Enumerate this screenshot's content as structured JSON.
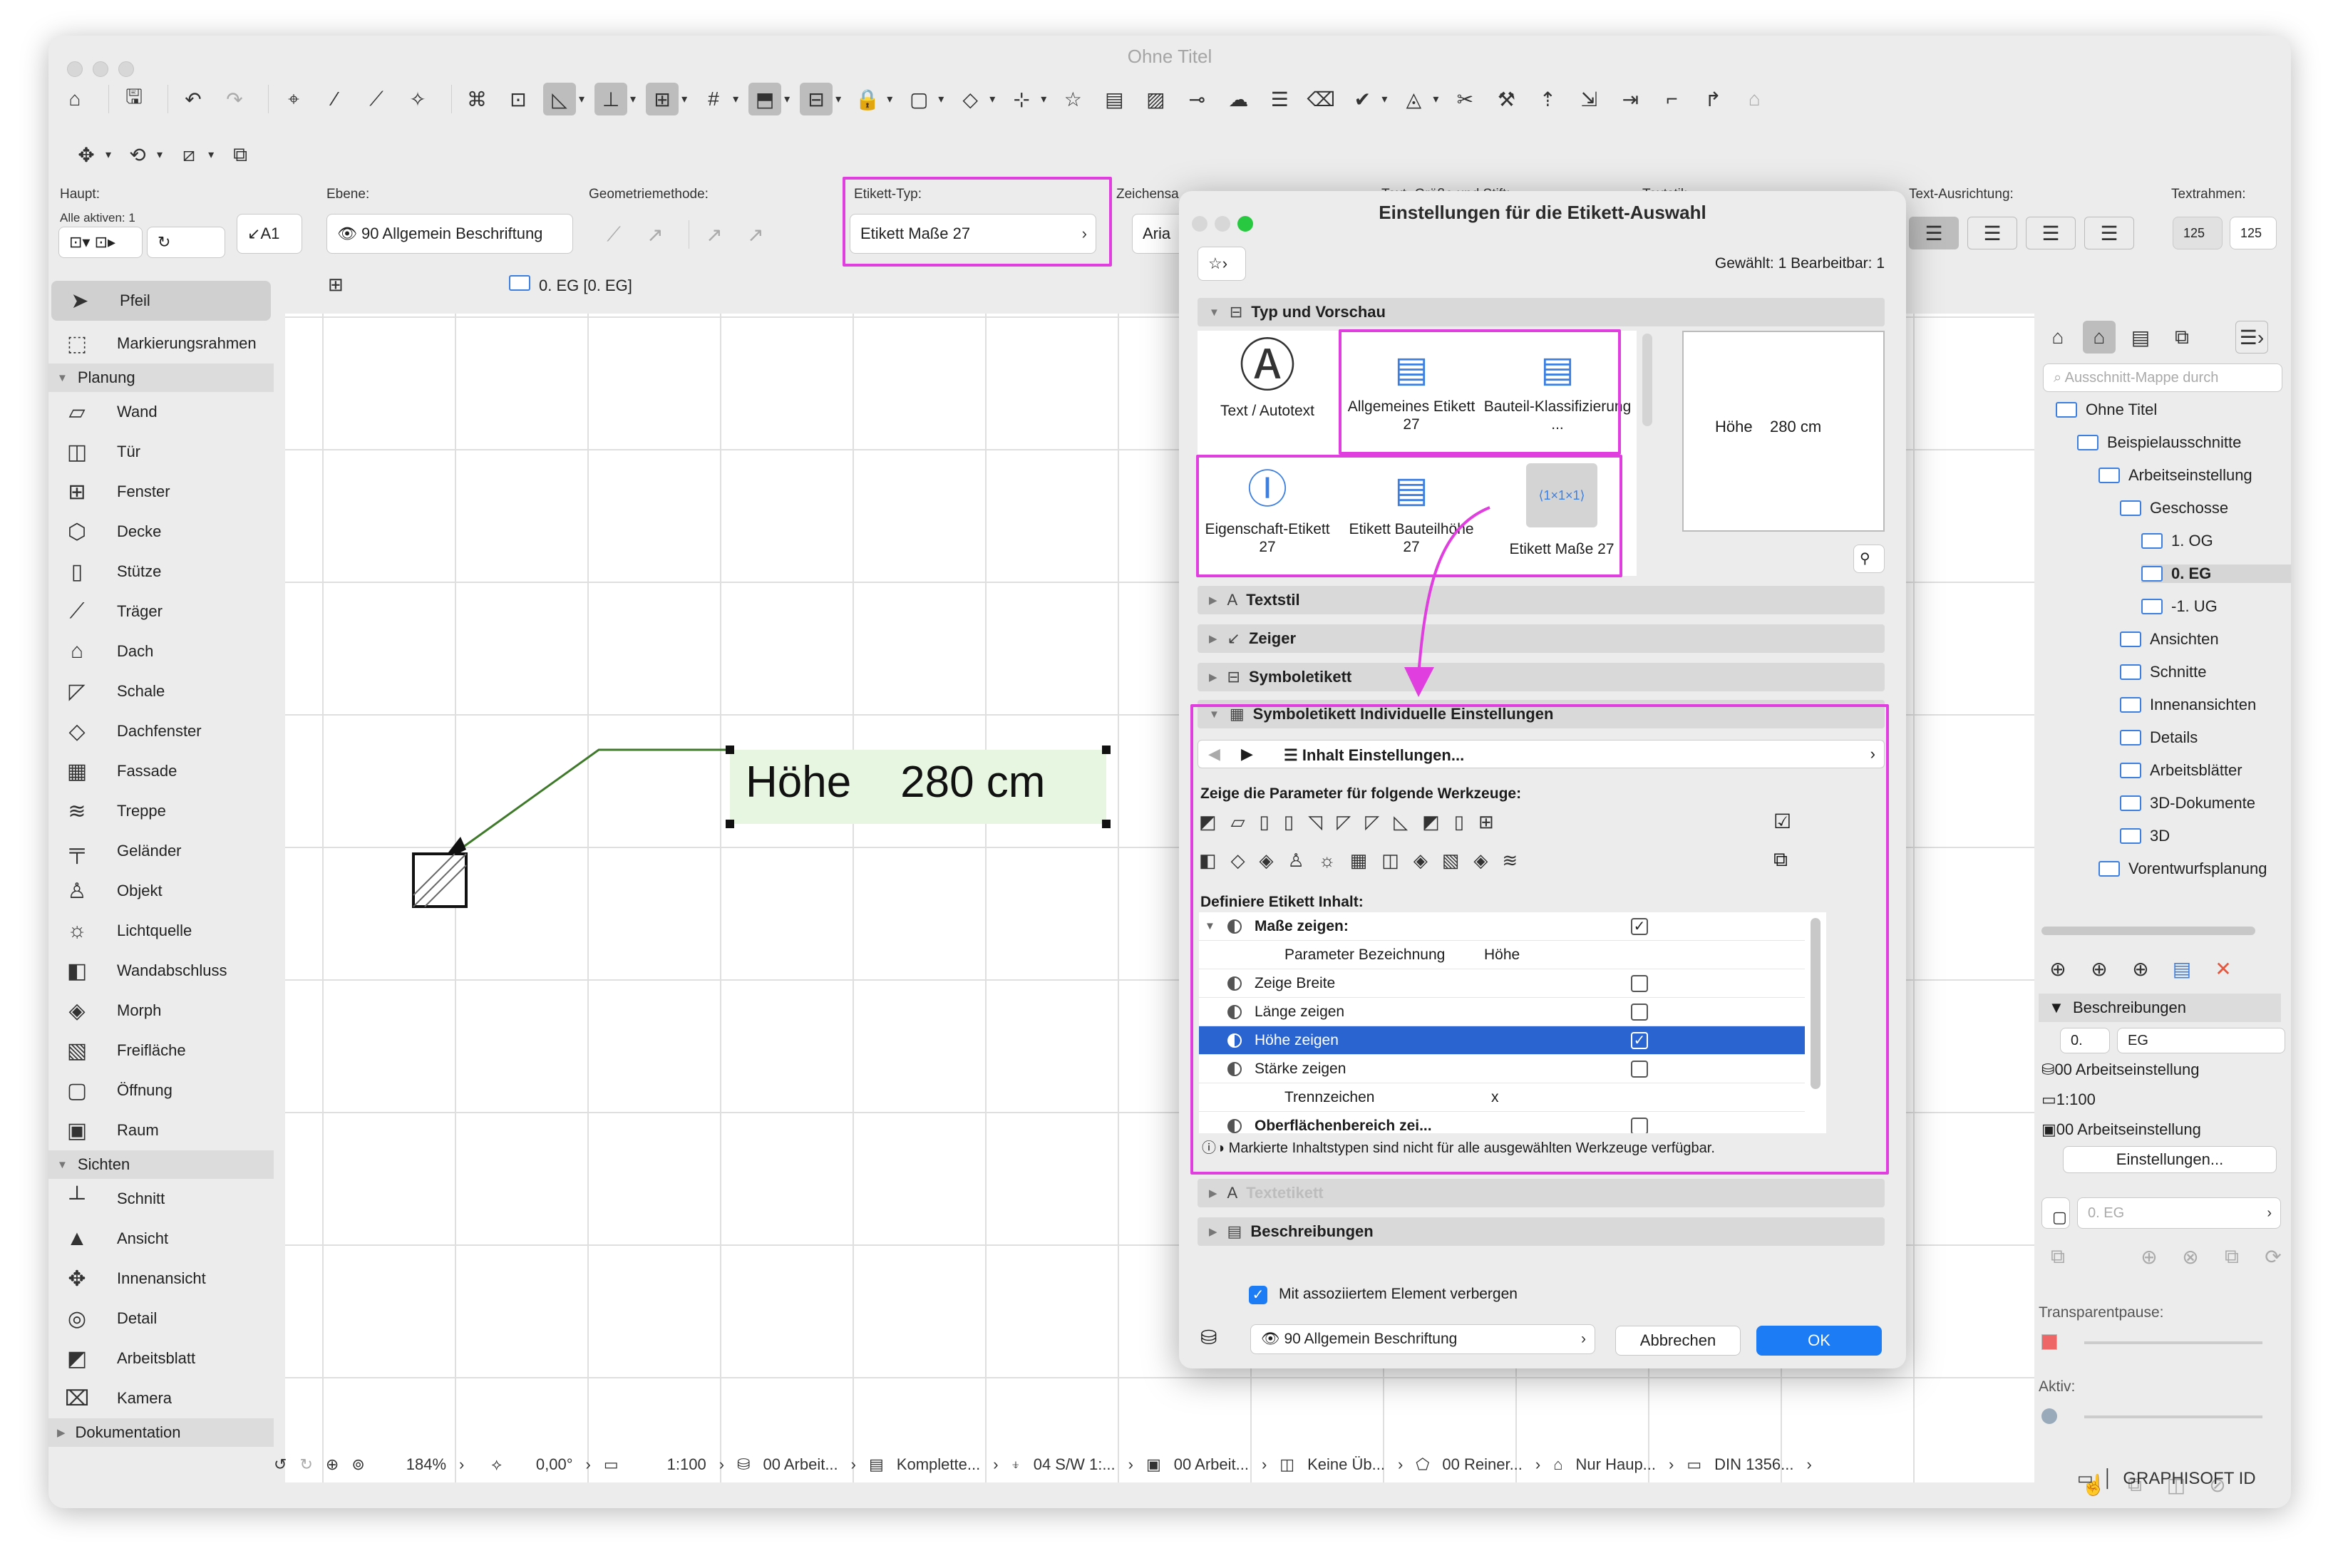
{
  "window": {
    "title": "Ohne Titel"
  },
  "info_bar": {
    "haupt_label": "Haupt:",
    "alle_aktiven": "Alle aktiven: 1",
    "a1": "A1",
    "ebene_label": "Ebene:",
    "ebene_value": "90 Allgemein Beschriftung",
    "geometrie_label": "Geometriemethode:",
    "etikett_typ_label": "Etikett-Typ:",
    "etikett_typ_value": "Etikett Maße 27",
    "zeichensatz_label": "Zeichensa",
    "zeichensatz_value": "Aria",
    "text_groesse_label": "Text- Größe und Stift:",
    "textstil_label": "Textstil:",
    "text_ausrichtung_label": "Text-Ausrichtung:",
    "textrahmen_label": "Textrahmen:",
    "textrahmen_a": "125",
    "textrahmen_b": "125"
  },
  "view_tab": {
    "label": "0. EG [0. EG]"
  },
  "toolbox": {
    "items_top": [
      {
        "label": "Pfeil",
        "icon": "arrow-pointer-icon"
      },
      {
        "label": "Markierungsrahmen",
        "icon": "marquee-icon"
      }
    ],
    "planung_label": "Planung",
    "planung": [
      {
        "label": "Wand",
        "icon": "wall-icon",
        "g": "▱"
      },
      {
        "label": "Tür",
        "icon": "door-icon",
        "g": "◫"
      },
      {
        "label": "Fenster",
        "icon": "window-icon",
        "g": "⊞"
      },
      {
        "label": "Decke",
        "icon": "slab-icon",
        "g": "⬡"
      },
      {
        "label": "Stütze",
        "icon": "column-icon",
        "g": "▯"
      },
      {
        "label": "Träger",
        "icon": "beam-icon",
        "g": "⟋"
      },
      {
        "label": "Dach",
        "icon": "roof-icon",
        "g": "⌂"
      },
      {
        "label": "Schale",
        "icon": "shell-icon",
        "g": "◸"
      },
      {
        "label": "Dachfenster",
        "icon": "skylight-icon",
        "g": "◇"
      },
      {
        "label": "Fassade",
        "icon": "curtain-wall-icon",
        "g": "▦"
      },
      {
        "label": "Treppe",
        "icon": "stair-icon",
        "g": "≋"
      },
      {
        "label": "Geländer",
        "icon": "railing-icon",
        "g": "╤"
      },
      {
        "label": "Objekt",
        "icon": "object-icon",
        "g": "♙"
      },
      {
        "label": "Lichtquelle",
        "icon": "lamp-icon",
        "g": "☼"
      },
      {
        "label": "Wandabschluss",
        "icon": "wall-end-icon",
        "g": "◧"
      },
      {
        "label": "Morph",
        "icon": "morph-icon",
        "g": "◈"
      },
      {
        "label": "Freifläche",
        "icon": "mesh-icon",
        "g": "▧"
      },
      {
        "label": "Öffnung",
        "icon": "opening-icon",
        "g": "▢"
      },
      {
        "label": "Raum",
        "icon": "zone-icon",
        "g": "▣"
      }
    ],
    "sichten_label": "Sichten",
    "sichten": [
      {
        "label": "Schnitt",
        "icon": "section-icon",
        "g": "┴"
      },
      {
        "label": "Ansicht",
        "icon": "elevation-icon",
        "g": "▲"
      },
      {
        "label": "Innenansicht",
        "icon": "interior-elevation-icon",
        "g": "✥"
      },
      {
        "label": "Detail",
        "icon": "detail-icon",
        "g": "◎"
      },
      {
        "label": "Arbeitsblatt",
        "icon": "worksheet-icon",
        "g": "◩"
      },
      {
        "label": "Kamera",
        "icon": "camera-icon",
        "g": "⌧"
      }
    ],
    "dokumentation_label": "Dokumentation"
  },
  "canvas": {
    "label_text": "Höhe    280 cm"
  },
  "status_bar": {
    "zoom": "184%",
    "angle": "0,00°",
    "scale": "1:100",
    "layer": "00 Arbeit...",
    "model": "Komplette...",
    "pen": "04 S/W 1:...",
    "view": "00 Arbeit...",
    "override": "Keine Üb...",
    "renovation": "00 Reiner...",
    "structure": "Nur Haup...",
    "dim": "DIN 1356..."
  },
  "navigator": {
    "search_placeholder": "Ausschnitt-Mappe durch",
    "tree": [
      "Ohne Titel",
      "Beispielausschnitte",
      "Arbeitseinstellung",
      "Geschosse",
      "1. OG",
      "0. EG",
      "-1. UG",
      "Ansichten",
      "Schnitte",
      "Innenansichten",
      "Details",
      "Arbeitsblätter",
      "3D-Dokumente",
      "3D",
      "Vorentwurfsplanung"
    ],
    "beschreibungen": "Beschreibungen",
    "id_value": "0.",
    "name_value": "EG",
    "props": [
      "00 Arbeitseinstellung",
      "1:100",
      "00 Arbeitseinstellung"
    ],
    "einstellungen_btn": "Einstellungen...",
    "view_ref": "0. EG",
    "transparenz": "Transparentpause:",
    "aktiv": "Aktiv:",
    "brand": "GRAPHISOFT ID"
  },
  "dialog": {
    "title": "Einstellungen für die Etikett-Auswahl",
    "selection_info": "Gewählt: 1 Bearbeitbar: 1",
    "sections": {
      "typ": "Typ und Vorschau",
      "textstil": "Textstil",
      "zeiger": "Zeiger",
      "symbol": "Symboletikett",
      "indiv": "Symboletikett Individuelle Einstellungen",
      "textetikett": "Textetikett",
      "beschr": "Beschreibungen"
    },
    "types": [
      {
        "label": "Text / Autotext"
      },
      {
        "label": "Allgemeines Etikett 27"
      },
      {
        "label": "Bauteil-Klassifizierung ..."
      },
      {
        "label": "Eigenschaft-Etikett 27"
      },
      {
        "label": "Etikett Bauteilhöhe 27"
      },
      {
        "label": "Etikett Maße 27"
      }
    ],
    "preview_text": "Höhe    280 cm",
    "inhalt_btn": "Inhalt Einstellungen...",
    "zeige_param": "Zeige die Parameter für folgende Werkzeuge:",
    "definiere": "Definiere Etikett Inhalt:",
    "rows": [
      {
        "label": "Maße zeigen:",
        "value": "✓",
        "bold": true
      },
      {
        "label": "Parameter Bezeichnung",
        "value": "Höhe"
      },
      {
        "label": "Zeige Breite",
        "value": ""
      },
      {
        "label": "Länge zeigen",
        "value": ""
      },
      {
        "label": "Höhe zeigen",
        "value": "✓"
      },
      {
        "label": "Stärke zeigen",
        "value": ""
      },
      {
        "label": "Trennzeichen",
        "value": "x"
      },
      {
        "label": "Oberflächenbereich zei...",
        "value": "",
        "bold": true
      }
    ],
    "note": "Markierte Inhaltstypen sind nicht für alle ausgewählten Werkzeuge verfügbar.",
    "hide_with_element": "Mit assoziiertem Element verbergen",
    "layer": "90 Allgemein Beschriftung",
    "cancel": "Abbrechen",
    "ok": "OK"
  },
  "colors": {
    "highlight": "#e13ee0",
    "selection": "#2a64d1",
    "ok": "#1b7cf5",
    "leader": "#3f7a2a"
  }
}
